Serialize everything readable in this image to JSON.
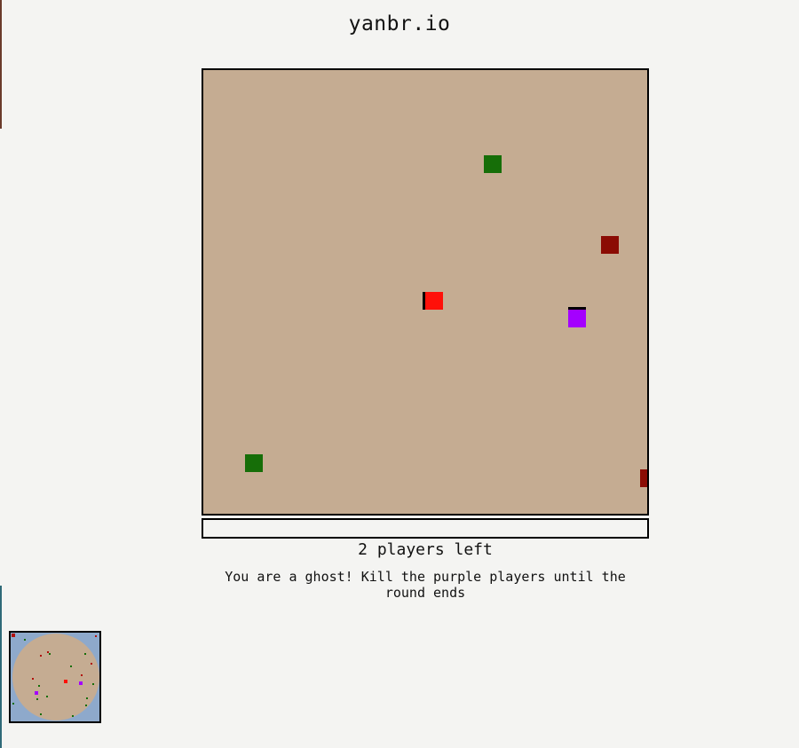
{
  "page": {
    "title": "yanbr.io"
  },
  "status": {
    "players_left": "2 players left",
    "message": "You are a ghost! Kill the purple players until the round ends"
  },
  "arena": {
    "background_color": "#c5ac92",
    "entity_colors": {
      "ally": "#166e08",
      "enemy": "#8b0c04",
      "self": "#ff1009",
      "purple_player": "#a400ff"
    }
  },
  "minimap": {
    "water_color": "#8ea9cb",
    "zone_color": "#c5ac92"
  }
}
